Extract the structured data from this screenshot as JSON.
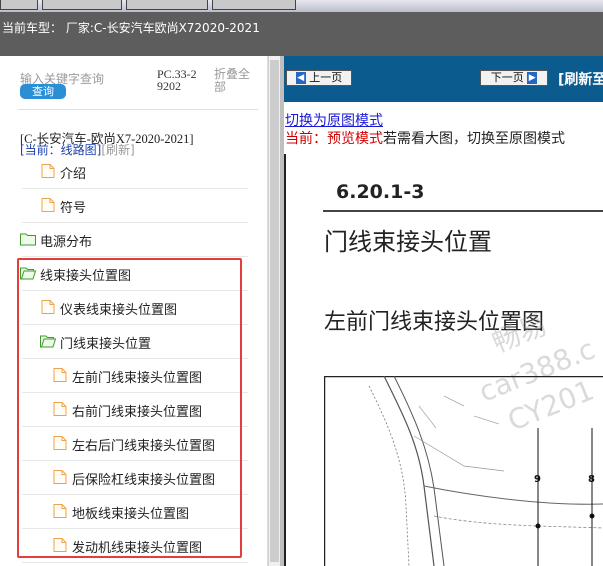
{
  "header": {
    "model_line": "当前车型： 厂家:C-长安汽车欧尚X72020-2021"
  },
  "search": {
    "placeholder": "输入关键字查询",
    "query_button": "查询",
    "code": "PC.33-29202",
    "collapse_all": "折叠全部"
  },
  "breadcrumb": {
    "title": "[C-长安汽车-欧尚X7-2020-2021]",
    "current_prefix": "[当前：线路图]",
    "refresh": "[刷新]"
  },
  "tree": {
    "items": [
      {
        "label": "介绍",
        "type": "file",
        "level": 1
      },
      {
        "label": "符号",
        "type": "file",
        "level": 1
      },
      {
        "label": "电源分布",
        "type": "folder",
        "level": 0
      },
      {
        "label": "线束接头位置图",
        "type": "folder-open",
        "level": 0
      },
      {
        "label": "仪表线束接头位置图",
        "type": "file",
        "level": 1
      },
      {
        "label": "门线束接头位置",
        "type": "folder-open",
        "level": 1
      },
      {
        "label": "左前门线束接头位置图",
        "type": "file",
        "level": 2
      },
      {
        "label": "右前门线束接头位置图",
        "type": "file",
        "level": 2
      },
      {
        "label": "左右后门线束接头位置图",
        "type": "file",
        "level": 2
      },
      {
        "label": "后保险杠线束接头位置图",
        "type": "file",
        "level": 2
      },
      {
        "label": "地板线束接头位置图",
        "type": "file",
        "level": 2
      },
      {
        "label": "发动机线束接头位置图",
        "type": "file",
        "level": 2
      }
    ]
  },
  "nav": {
    "prev": "上一页",
    "next": "下一页",
    "refresh": "[刷新至"
  },
  "viewer": {
    "switch_link": "切换为原图模式",
    "mode_current": "当前：预览模式",
    "mode_hint": "若需看大图，切换至原图模式"
  },
  "document": {
    "section": "6.20.1-3",
    "title": "门线束接头位置",
    "subtitle": "左前门线束接头位置图",
    "watermark_1": "畅易",
    "watermark_2": "car388.c",
    "watermark_3": "CY201",
    "callout_a": "9",
    "callout_b": "8"
  },
  "colors": {
    "nav_bar": "#0c5b8f",
    "highlight_box": "#e33d3d",
    "query_button": "#2b8fd6",
    "link": "#1a1ad6",
    "mode_red": "#d40000"
  }
}
